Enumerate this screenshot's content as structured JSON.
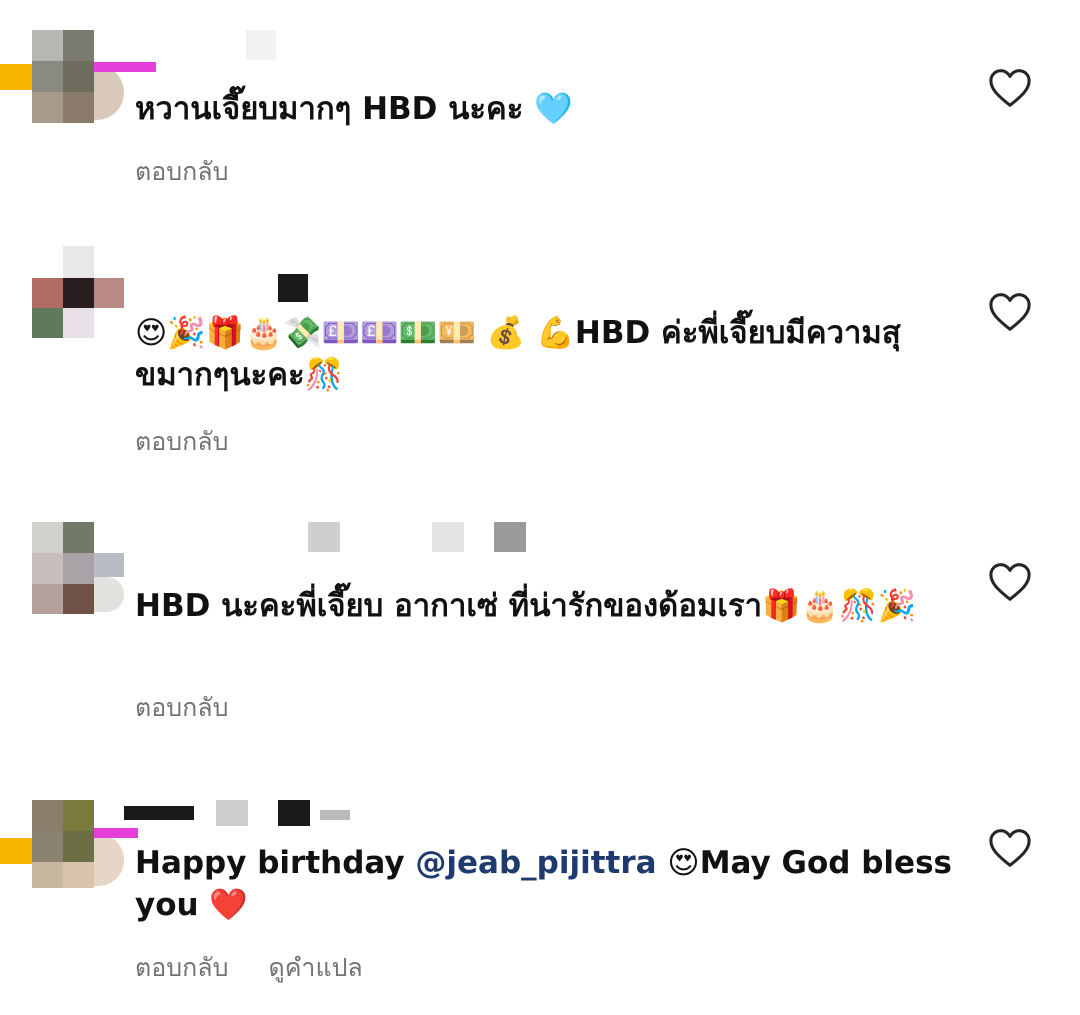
{
  "colors": {
    "text": "#111111",
    "muted": "#737373",
    "mention": "#1e3a6e",
    "heart_outline": "#262626"
  },
  "comments": [
    {
      "text": "หวานเจี๊ยบมากๆ HBD นะคะ 🩵",
      "reply_label": "ตอบกลับ"
    },
    {
      "text": "😍🎉🎁🎂💸💷💷💵💴 💰 💪HBD ค่ะพี่เจี๊ยบมีความสุขมากๆนะคะ🎊",
      "reply_label": "ตอบกลับ"
    },
    {
      "text": "HBD นะคะพี่เจี๊ยบ อากาเซ่ ที่น่ารักของด้อมเรา🎁🎂🎊🎉",
      "reply_label": "ตอบกลับ"
    },
    {
      "text_before": "Happy birthday ",
      "mention": "@jeab_pijittra",
      "text_after": " 😍May God bless you ❤️",
      "reply_label": "ตอบกลับ",
      "translate_label": "ดูคำแปล"
    }
  ],
  "icons": {
    "like": "heart-outline-icon"
  }
}
